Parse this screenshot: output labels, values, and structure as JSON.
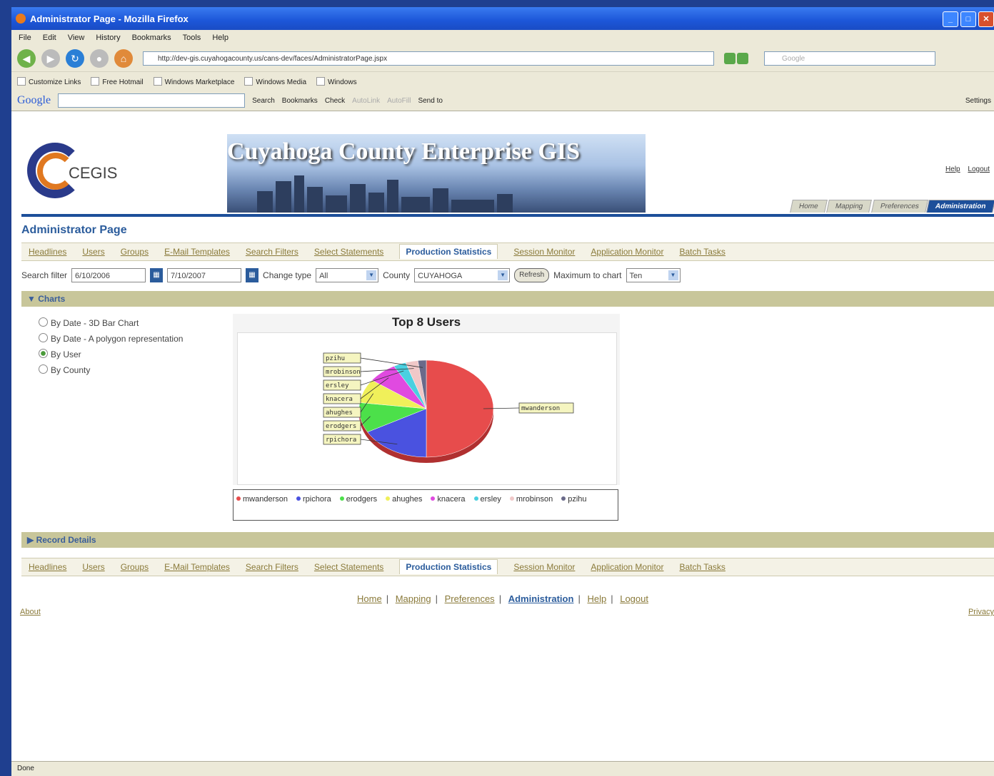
{
  "window": {
    "title": "Administrator Page - Mozilla Firefox"
  },
  "menu": [
    "File",
    "Edit",
    "View",
    "History",
    "Bookmarks",
    "Tools",
    "Help"
  ],
  "address": {
    "url": "http://dev-gis.cuyahogacounty.us/cans-dev/faces/AdministratorPage.jspx",
    "search_placeholder": "Google"
  },
  "bookmarks": [
    "Customize Links",
    "Free Hotmail",
    "Windows Marketplace",
    "Windows Media",
    "Windows"
  ],
  "googlebar": {
    "logo": "Google",
    "search": "Search",
    "bookmarks": "Bookmarks",
    "check": "Check",
    "autolink": "AutoLink",
    "autofill": "AutoFill",
    "sendto": "Send to",
    "settings": "Settings"
  },
  "site": {
    "title": "Cuyahoga County Enterprise GIS",
    "logo_text": "CEGIS",
    "help": "Help",
    "logout": "Logout",
    "main_tabs": [
      "Home",
      "Mapping",
      "Preferences",
      "Administration"
    ],
    "page_title": "Administrator Page"
  },
  "subtabs": [
    "Headlines",
    "Users",
    "Groups",
    "E-Mail Templates",
    "Search Filters",
    "Select Statements",
    "Production Statistics",
    "Session Monitor",
    "Application Monitor",
    "Batch Tasks"
  ],
  "filters": {
    "label": "Search filter",
    "from_date": "6/10/2006",
    "to_date": "7/10/2007",
    "change_type_label": "Change type",
    "change_type": "All",
    "county_label": "County",
    "county": "CUYAHOGA",
    "refresh": "Refresh",
    "max_label": "Maximum to chart",
    "max": "Ten"
  },
  "charts_section": "Charts",
  "chart_options": [
    "By Date - 3D Bar Chart",
    "By Date - A polygon representation",
    "By User",
    "By County"
  ],
  "record_section": "Record Details",
  "footer": {
    "links": [
      "Home",
      "Mapping",
      "Preferences",
      "Administration",
      "Help",
      "Logout"
    ],
    "about": "About",
    "privacy": "Privacy"
  },
  "status": "Done",
  "colors": {
    "accent": "#2b5c9c",
    "section": "#c8c69a"
  },
  "chart_data": {
    "type": "pie",
    "title": "Top 8 Users",
    "categories": [
      "mwanderson",
      "rpichora",
      "erodgers",
      "ahughes",
      "knacera",
      "ersley",
      "mrobinson",
      "pzihu"
    ],
    "values": [
      50,
      17,
      10,
      8,
      7,
      3,
      3,
      2
    ],
    "colors": [
      "#e74c4c",
      "#4a52e0",
      "#4ce04a",
      "#f0f05a",
      "#e04ae0",
      "#4ad0e0",
      "#f0c8c8",
      "#6a6a8a"
    ],
    "labels": [
      "mwanderson",
      "rpichora",
      "erodgers",
      "ahughes",
      "knacera",
      "ersley",
      "mrobinson",
      "pzihu"
    ]
  }
}
